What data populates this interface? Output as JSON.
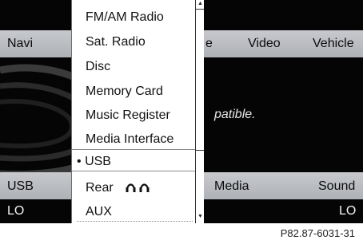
{
  "top_bar": {
    "navi": "Navi",
    "partial_label": "e",
    "video": "Video",
    "vehicle": "Vehicle"
  },
  "message": "patible.",
  "bottom_bar": {
    "usb": "USB",
    "media": "Media",
    "sound": "Sound"
  },
  "status": {
    "left_value": "LO",
    "right_value": "LO"
  },
  "source_menu": {
    "items": [
      {
        "label": "FM/AM Radio"
      },
      {
        "label": "Sat. Radio"
      },
      {
        "label": "Disc"
      },
      {
        "label": "Memory Card"
      },
      {
        "label": "Music Register"
      },
      {
        "label": "Media Interface"
      },
      {
        "label": "USB",
        "selected": true,
        "bullet": "•"
      },
      {
        "label": "Rear",
        "icon": "headphones-icon"
      },
      {
        "label": "AUX"
      }
    ],
    "selected_index": 6
  },
  "caption": "P82.87-6031-31"
}
